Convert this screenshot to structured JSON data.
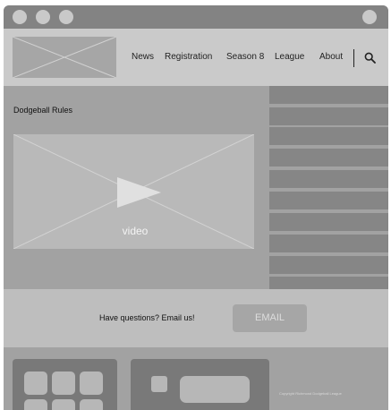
{
  "nav": {
    "items": [
      {
        "label": "News"
      },
      {
        "label": "Registration"
      },
      {
        "label": "Season 8"
      },
      {
        "label": "League"
      },
      {
        "label": "About"
      }
    ]
  },
  "main": {
    "title": "Dodgeball Rules",
    "video_label": "video"
  },
  "contact": {
    "text": "Have questions? Email us!",
    "button_label": "EMAIL"
  },
  "footer": {
    "copyright": "Copyright Richmond Dodgeball League"
  },
  "colors": {
    "titlebar": "#838383",
    "header": "#cacaca",
    "main": "#a2a2a2",
    "side_item": "#868686",
    "contact": "#bebebe",
    "button": "#a6a6a6",
    "footer_card": "#797979"
  },
  "icons": {
    "search": "search-icon",
    "play": "play-icon"
  }
}
